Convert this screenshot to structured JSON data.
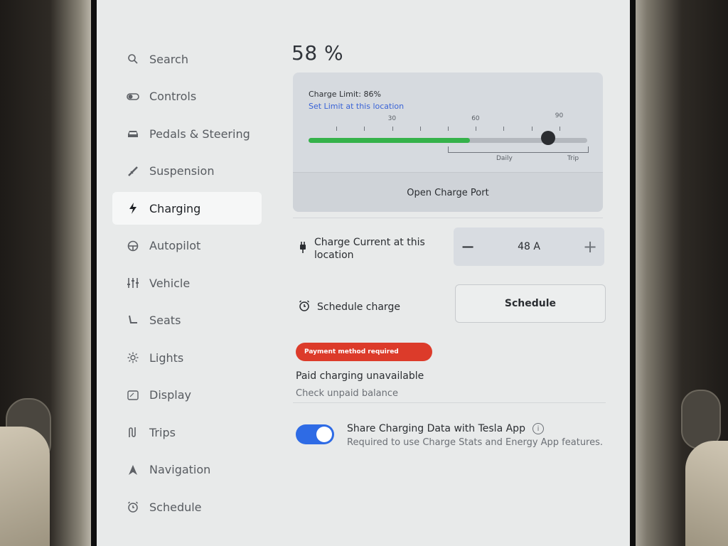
{
  "sidebar": {
    "items": [
      {
        "label": "Search",
        "icon": "search-icon"
      },
      {
        "label": "Controls",
        "icon": "toggle-icon"
      },
      {
        "label": "Pedals & Steering",
        "icon": "car-icon"
      },
      {
        "label": "Suspension",
        "icon": "suspension-icon"
      },
      {
        "label": "Charging",
        "icon": "bolt-icon",
        "active": true
      },
      {
        "label": "Autopilot",
        "icon": "steering-wheel-icon"
      },
      {
        "label": "Vehicle",
        "icon": "sliders-icon"
      },
      {
        "label": "Seats",
        "icon": "seat-icon"
      },
      {
        "label": "Lights",
        "icon": "sun-icon"
      },
      {
        "label": "Display",
        "icon": "display-icon"
      },
      {
        "label": "Trips",
        "icon": "trips-icon"
      },
      {
        "label": "Navigation",
        "icon": "navigation-arrow-icon"
      },
      {
        "label": "Schedule",
        "icon": "alarm-clock-icon"
      }
    ]
  },
  "charging": {
    "battery_percent": "58 %",
    "limit_title": "Charge Limit: 86%",
    "limit_link": "Set Limit at this location",
    "limit_value": 86,
    "current_level": 58,
    "ticks": [
      "30",
      "60",
      "90"
    ],
    "range_daily": "Daily",
    "range_trip": "Trip",
    "open_port_label": "Open Charge Port",
    "current_label": "Charge Current at this location",
    "current_value": "48 A",
    "minus_label": "−",
    "plus_label": "+",
    "schedule_label": "Schedule charge",
    "schedule_button": "Schedule",
    "payment_badge": "Payment method required",
    "paid_title": "Paid charging unavailable",
    "paid_sub": "Check unpaid balance",
    "share_title": "Share Charging Data with Tesla App",
    "share_sub": "Required to use Charge Stats and Energy App features.",
    "share_enabled": true,
    "info_glyph": "i"
  },
  "colors": {
    "accent_blue": "#2e6be5",
    "link_blue": "#3a63d6",
    "charge_green": "#35b24a",
    "badge_red": "#dc3b2a"
  }
}
